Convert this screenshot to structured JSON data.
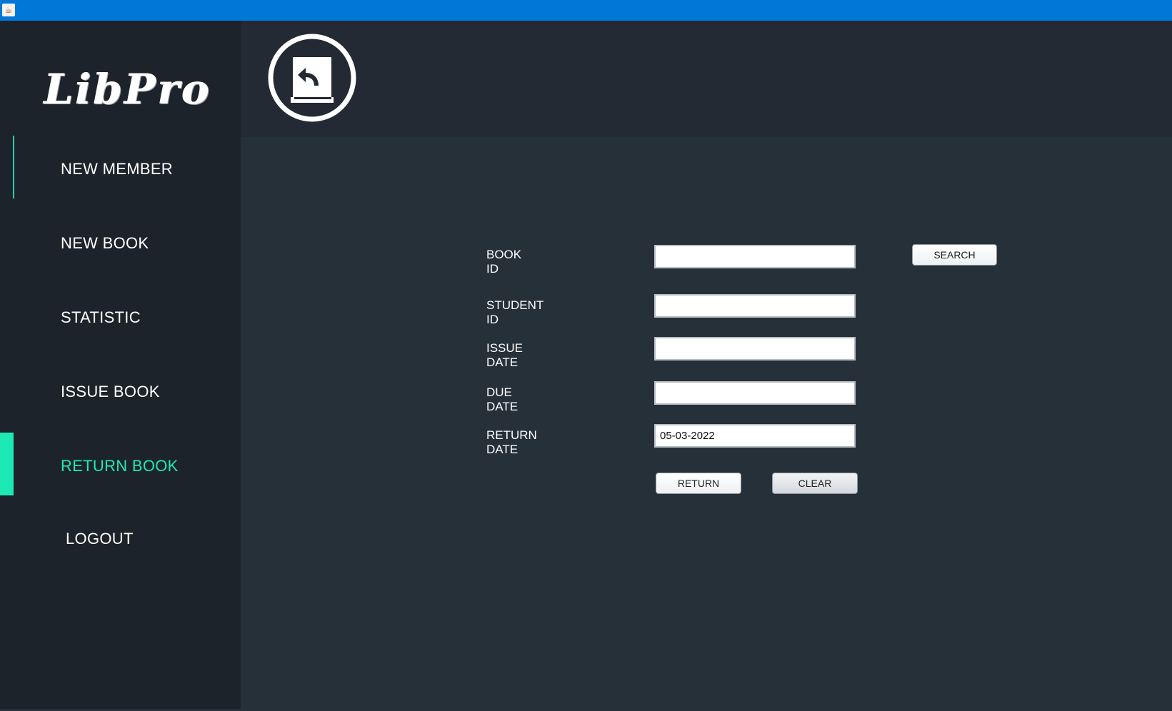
{
  "window": {
    "title_icon": "java-app-icon"
  },
  "sidebar": {
    "logo": "LibPro",
    "items": [
      {
        "label": "NEW MEMBER"
      },
      {
        "label": "NEW BOOK"
      },
      {
        "label": "STATISTIC"
      },
      {
        "label": "ISSUE BOOK"
      },
      {
        "label": "RETURN BOOK"
      },
      {
        "label": "LOGOUT"
      }
    ],
    "active_item": "RETURN BOOK"
  },
  "header": {
    "icon": "return-book-icon"
  },
  "form": {
    "book_id_label": "BOOK ID",
    "book_id_value": "",
    "student_id_label": "STUDENT ID",
    "student_id_value": "",
    "issue_date_label": "ISSUE DATE",
    "issue_date_value": "",
    "due_date_label": "DUE DATE",
    "due_date_value": "",
    "return_date_label": "RETURN DATE",
    "return_date_value": "05-03-2022",
    "search_label": "SEARCH",
    "return_label": "RETURN",
    "clear_label": "CLEAR"
  },
  "colors": {
    "titlebar": "#0078d7",
    "sidebar_bg": "#1d232a",
    "header_bg": "#232a33",
    "content_bg": "#263039",
    "accent": "#1de9b6"
  }
}
